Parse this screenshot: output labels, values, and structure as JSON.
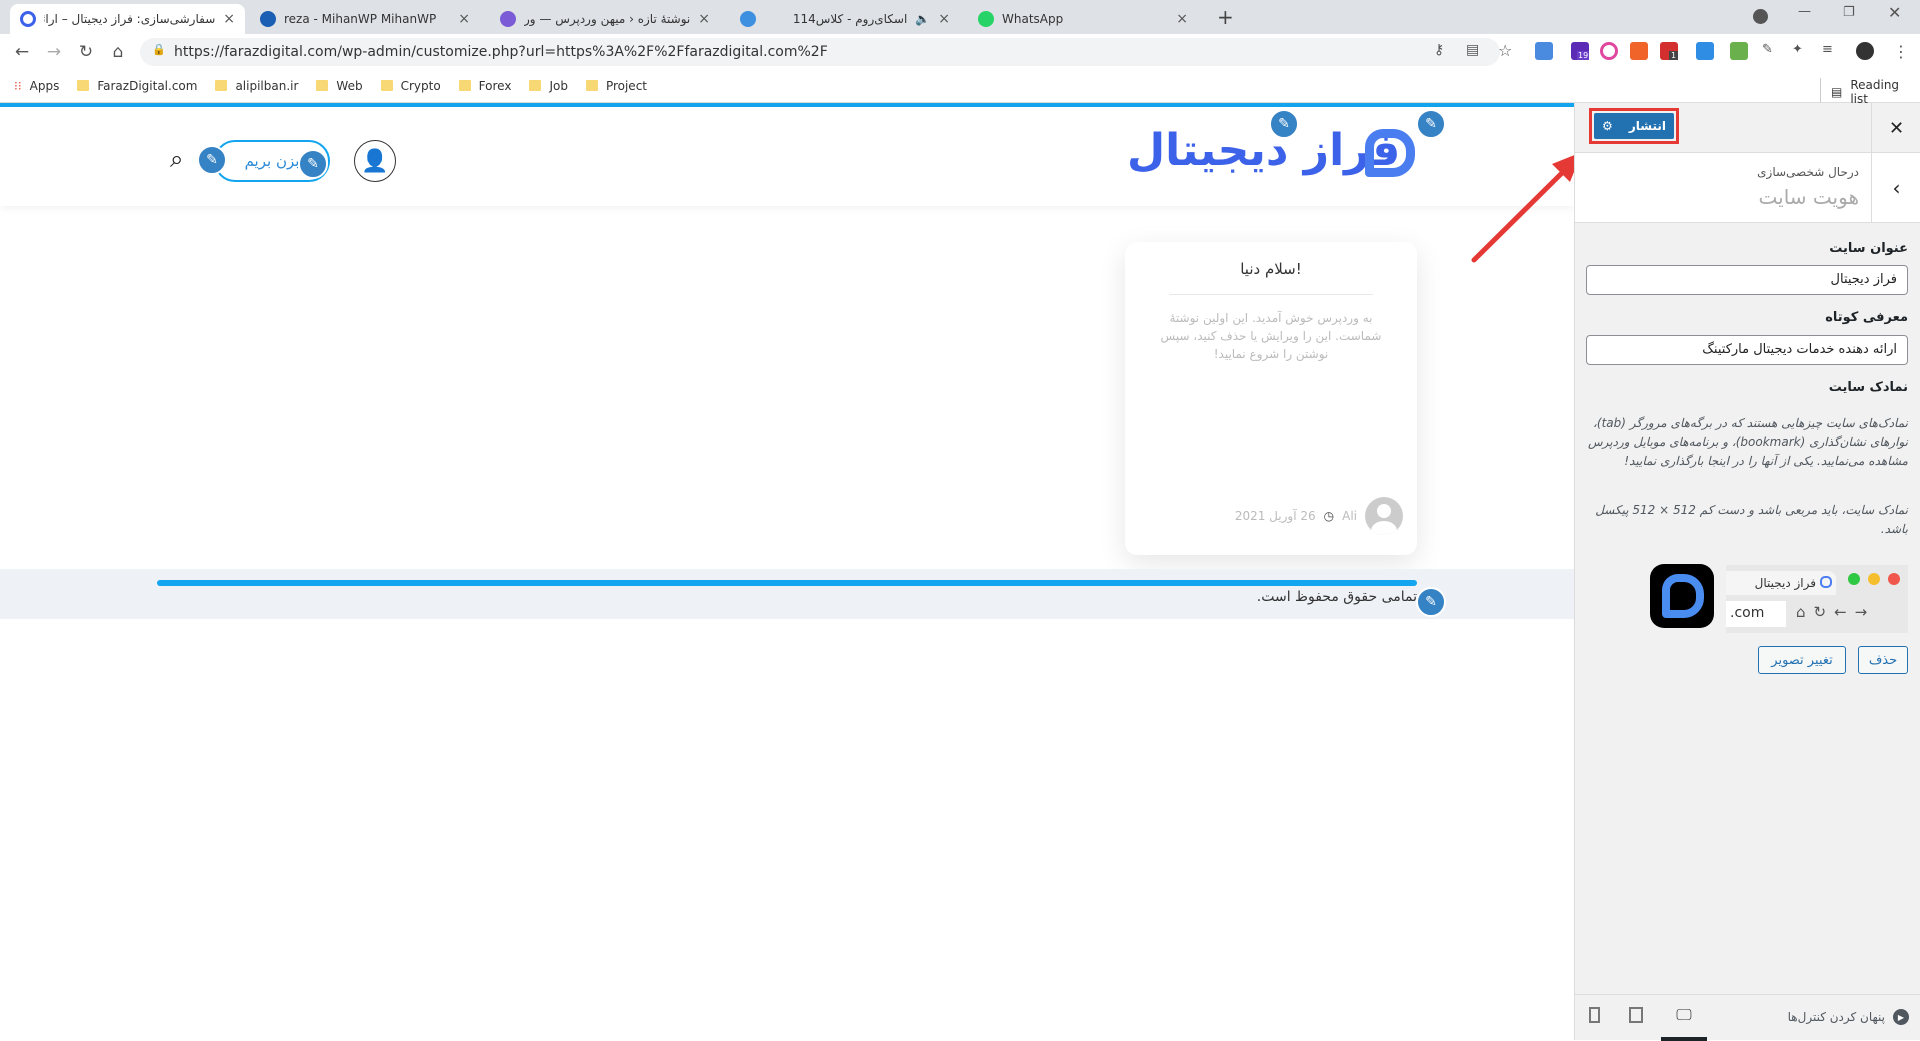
{
  "browser": {
    "tabs": [
      {
        "title": "سفارشی‌سازی: فراز دیجیتال – ارائه د",
        "active": true,
        "icon_color": "#3b62e8"
      },
      {
        "title": "reza - MihanWP MihanWP",
        "active": false,
        "icon_color": "#1a5fb4"
      },
      {
        "title": "نوشتهٔ تازه ‹ میهن وردپرس — وردپر",
        "active": false,
        "icon_color": "#7b5cd6"
      },
      {
        "title": "اسکای‌روم - کلاس114",
        "active": false,
        "icon_color": "#3d8fe0"
      },
      {
        "title": "WhatsApp",
        "active": false,
        "icon_color": "#25d366"
      }
    ],
    "url": "https://farazdigital.com/wp-admin/customize.php?url=https%3A%2F%2Ffarazdigital.com%2F",
    "bookmarks": [
      "Apps",
      "FarazDigital.com",
      "alipilban.ir",
      "Web",
      "Crypto",
      "Forex",
      "Job",
      "Project"
    ],
    "reading_list": "Reading list",
    "badges": {
      "ext2": "19",
      "ext5": "1",
      "ext1": "8"
    }
  },
  "site": {
    "logo_text": "فراز دیجیتال",
    "cta": "بزن بریم",
    "post": {
      "title": "سلام دنیا!",
      "excerpt": "به وردپرس خوش آمدید. این اولین نوشتهٔ شماست. این را ویرایش یا حذف کنید، سپس نوشتن را شروع نمایید!",
      "author": "Ali",
      "date": "26 آوریل 2021"
    },
    "copyright": "تمامی حقوق محفوظ است.",
    "accent": "#13a5ef"
  },
  "customizer": {
    "publish": "انتشار",
    "section_sub": "درحال شخصی‌سازی",
    "section_title": "هویت سایت",
    "site_title_label": "عنوان سایت",
    "site_title_value": "فراز دیجیتال",
    "tagline_label": "معرفی کوتاه",
    "tagline_value": "ارائه دهنده خدمات دیجیتال مارکتینگ",
    "icon_label": "نمادک سایت",
    "icon_desc1": "نمادک‌های سایت چیزهایی هستند که در برگه‌های مرورگر (tab)، نوارهای نشان‌گذاری (bookmark)، و برنامه‌های موبایل وردپرس مشاهده می‌نمایید. یکی از آنها را در اینجا بارگذاری نمایید!",
    "icon_desc2": "نمادک سایت، باید مربعی باشد و دست کم 512 × 512 پیکسل باشد.",
    "preview_tab": "فراز دیجیتال",
    "preview_url": ".com",
    "remove": "حذف",
    "change": "تغییر تصویر",
    "hide_controls": "پنهان کردن کنترل‌ها",
    "primary": "#2271b1"
  }
}
